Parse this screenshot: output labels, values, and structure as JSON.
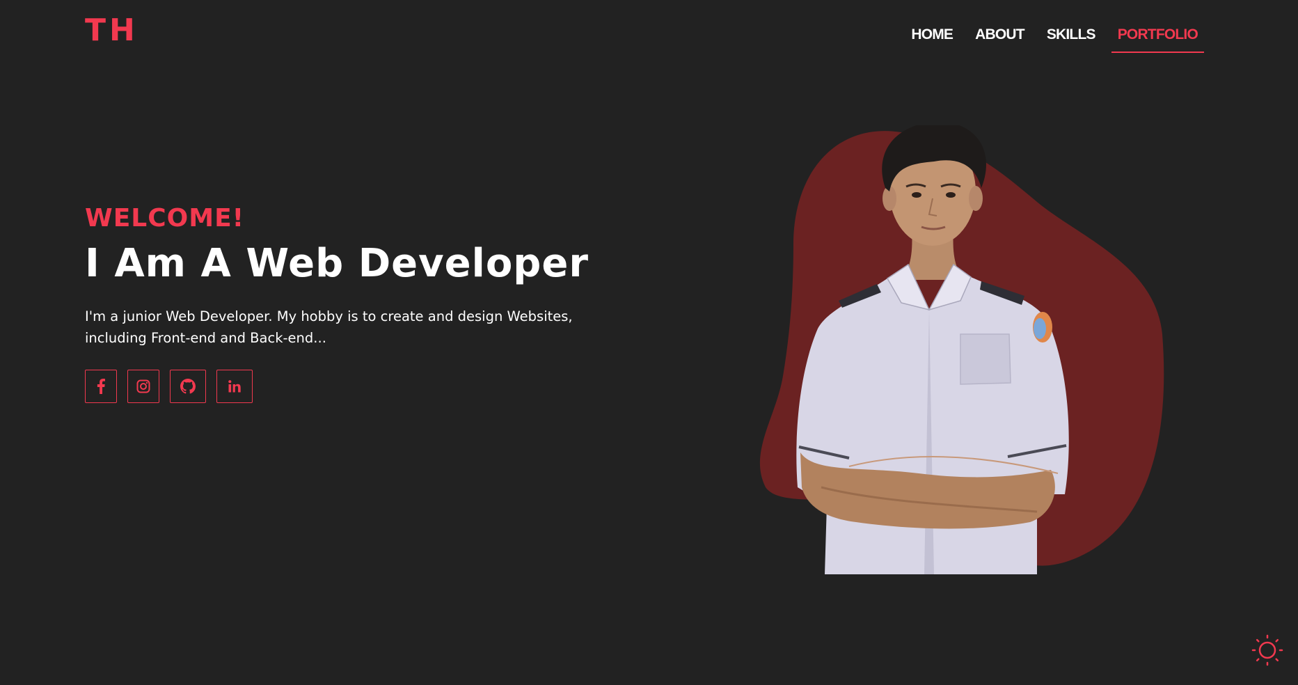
{
  "header": {
    "logo": "TH",
    "nav": [
      {
        "label": "HOME",
        "active": false
      },
      {
        "label": "ABOUT",
        "active": false
      },
      {
        "label": "SKILLS",
        "active": false
      },
      {
        "label": "PORTFOLIO",
        "active": true
      }
    ]
  },
  "hero": {
    "welcome": "WELCOME!",
    "headline": "I Am A Web Developer",
    "bio": "I'm a junior Web Developer. My hobby is to create and design Websites, including Front-end and Back-end...",
    "socials": [
      {
        "icon": "facebook-icon"
      },
      {
        "icon": "instagram-icon"
      },
      {
        "icon": "github-icon"
      },
      {
        "icon": "linkedin-icon"
      }
    ]
  },
  "portrait": {
    "icon": "profile-photo"
  },
  "theme_toggle": {
    "icon": "sun-icon"
  },
  "colors": {
    "background": "#222222",
    "accent": "#f2394f",
    "blob": "#6b2222",
    "text": "#ffffff"
  }
}
